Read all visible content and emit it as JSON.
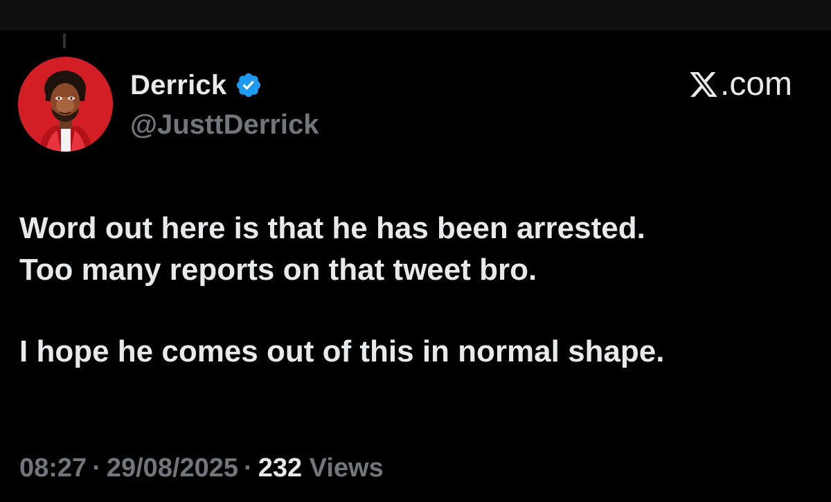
{
  "author": {
    "display_name": "Derrick",
    "handle": "@JusttDerrick",
    "verified": true,
    "avatar_icon": "avatar-image",
    "avatar_bg_color": "#d41e26",
    "verified_color": "#1d9bf0"
  },
  "brand": {
    "icon": "x-logo-icon",
    "text": ".com"
  },
  "tweet": {
    "lines": [
      "Word out here is that he has been arrested.",
      "Too many reports on that tweet bro.",
      "I hope he comes out of this in normal shape."
    ]
  },
  "meta": {
    "time": "08:27",
    "separator": "·",
    "date": "29/08/2025",
    "views_count": "232",
    "views_label": "Views"
  },
  "colors": {
    "background": "#000000",
    "primary_text": "#e7e9ea",
    "secondary_text": "#71767b"
  }
}
